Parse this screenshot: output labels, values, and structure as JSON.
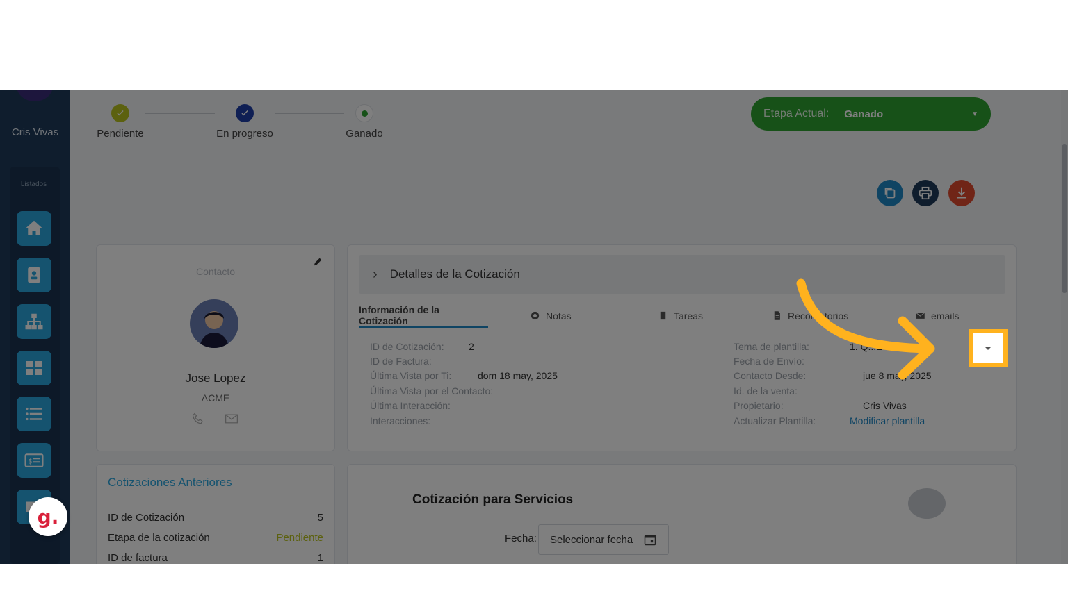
{
  "sidebar": {
    "user_name": "Cris Vivas",
    "section_label": "Listados",
    "items": [
      {
        "icon": "home-icon"
      },
      {
        "icon": "contact-card-icon"
      },
      {
        "icon": "org-chart-icon"
      },
      {
        "icon": "grid-icon"
      },
      {
        "icon": "list-icon"
      },
      {
        "icon": "invoice-icon"
      },
      {
        "icon": "mail-icon"
      }
    ],
    "colors": {
      "background": "#1f3a5a",
      "button": "#2aa6df"
    }
  },
  "stepper": {
    "steps": [
      {
        "label": "Pendiente",
        "color": "#b9c21f"
      },
      {
        "label": "En progreso",
        "color": "#1f3ea8"
      },
      {
        "label": "Ganado",
        "color": "#2ea330"
      }
    ]
  },
  "stage": {
    "label": "Etapa Actual:",
    "value": "Ganado",
    "color": "#2ea330"
  },
  "actions": [
    {
      "name": "duplicate",
      "color": "#1e88c7"
    },
    {
      "name": "print",
      "color": "#1f3a5a"
    },
    {
      "name": "download",
      "color": "#e04a2e"
    }
  ],
  "contact": {
    "title": "Contacto",
    "name": "Jose Lopez",
    "company": "ACME"
  },
  "previous_quotes": {
    "title": "Cotizaciones Anteriores",
    "rows": [
      {
        "label": "ID de Cotización",
        "value": "5"
      },
      {
        "label": "Etapa de la cotización",
        "value": "Pendiente"
      },
      {
        "label": "ID de factura",
        "value": "1"
      }
    ]
  },
  "details": {
    "header": "Detalles de la Cotización",
    "tabs": [
      {
        "label": "Información de la Cotización"
      },
      {
        "label": "Notas"
      },
      {
        "label": "Tareas"
      },
      {
        "label": "Recordatorios"
      },
      {
        "label": "emails"
      }
    ],
    "left_fields": [
      {
        "label": "ID de Cotización:",
        "value": "2"
      },
      {
        "label": "ID de Factura:",
        "value": ""
      },
      {
        "label": "Última Vista por Ti:",
        "value": "dom 18 may, 2025"
      },
      {
        "label": "Última Vista por el Contacto:",
        "value": ""
      },
      {
        "label": "Última Interacción:",
        "value": ""
      },
      {
        "label": "Interacciones:",
        "value": ""
      }
    ],
    "right_fields": [
      {
        "label": "Tema de plantilla:",
        "value": "1. Q...E"
      },
      {
        "label": "Fecha de Envío:",
        "value": ""
      },
      {
        "label": "Contacto Desde:",
        "value": "jue 8 may, 2025"
      },
      {
        "label": "Id. de la venta:",
        "value": ""
      },
      {
        "label": "Propietario:",
        "value": "Cris Vivas"
      },
      {
        "label": "Actualizar Plantilla:",
        "value": "Modificar plantilla"
      }
    ]
  },
  "service_quote": {
    "title": "Cotización para Servicios",
    "date_label": "Fecha:",
    "date_placeholder": "Seleccionar fecha"
  },
  "overlay": {
    "highlight_color": "#ffb21e",
    "brand_letter": "g."
  }
}
